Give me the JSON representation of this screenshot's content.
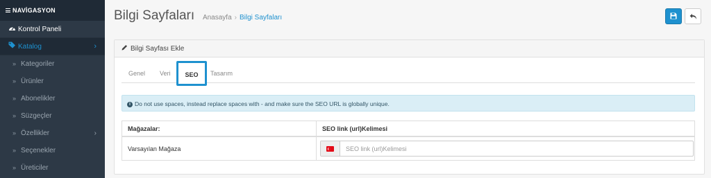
{
  "sidebar": {
    "header": "NAVİGASYON",
    "dashboard": {
      "label": "Kontrol Paneli",
      "icon": "dashboard-icon"
    },
    "catalog": {
      "label": "Katalog",
      "icon": "tags-icon"
    },
    "sub_items": [
      {
        "label": "Kategoriler"
      },
      {
        "label": "Ürünler"
      },
      {
        "label": "Abonelikler"
      },
      {
        "label": "Süzgeçler"
      },
      {
        "label": "Özellikler"
      },
      {
        "label": "Seçenekler"
      },
      {
        "label": "Üreticiler"
      }
    ]
  },
  "header": {
    "title": "Bilgi Sayfaları",
    "breadcrumb": {
      "home": "Anasayfa",
      "current": "Bilgi Sayfaları"
    }
  },
  "panel": {
    "title": "Bilgi Sayfası Ekle",
    "tabs": [
      {
        "label": "Genel"
      },
      {
        "label": "Veri"
      },
      {
        "label": "SEO",
        "active": true
      },
      {
        "label": "Tasarım"
      }
    ],
    "alert": "Do not use spaces, instead replace spaces with - and make sure the SEO URL is globally unique.",
    "table": {
      "headers": [
        "Mağazalar:",
        "SEO link (url)Kelimesi"
      ],
      "row": {
        "store": "Varsayılan Mağaza",
        "input_value": "",
        "input_placeholder": "SEO link (url)Kelimesi",
        "flag_icon": "turkey-flag-icon"
      }
    }
  },
  "colors": {
    "sidebar_bg": "#2d3946",
    "accent": "#1e91cf",
    "alert_bg": "#daeef6"
  }
}
